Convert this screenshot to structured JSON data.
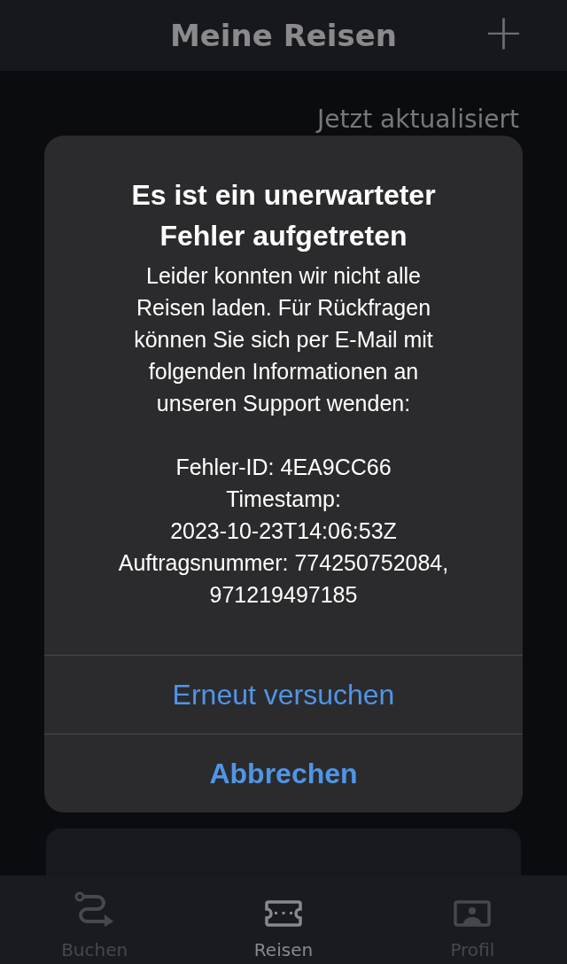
{
  "header": {
    "title": "Meine Reisen",
    "add_button": "+"
  },
  "refresh_status": "Jetzt aktualisiert",
  "dialog": {
    "title": "Es ist ein unerwarteter Fehler aufgetreten",
    "message": "Leider konnten wir nicht alle Reisen laden. Für Rückfragen können Sie sich per E-Mail mit folgenden Informationen an unseren Support wenden:",
    "details": [
      "Fehler-ID: 4EA9CC66",
      "Timestamp:",
      "2023-10-23T14:06:53Z",
      "Auftragsnummer: 774250752084,",
      "971219497185"
    ],
    "buttons": [
      {
        "label": "Erneut versuchen",
        "kind": "secondary"
      },
      {
        "label": "Abbrechen",
        "kind": "primary"
      }
    ]
  },
  "tabs": [
    {
      "label": "Buchen",
      "kind": "route",
      "selected": false
    },
    {
      "label": "Reisen",
      "kind": "ticket",
      "selected": true
    },
    {
      "label": "Profil",
      "kind": "profile",
      "selected": false
    }
  ]
}
